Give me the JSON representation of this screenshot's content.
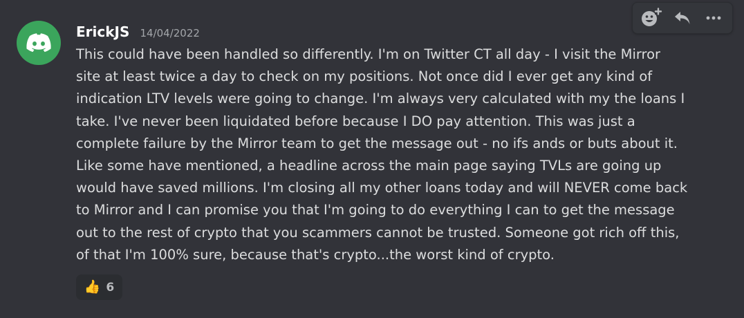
{
  "message": {
    "author": "ErickJS",
    "timestamp": "14/04/2022",
    "avatar_icon": "discord-logo-icon",
    "avatar_color": "#3ba55c",
    "text": "This could have been handled so differently. I'm on Twitter CT all day - I visit the Mirror\nsite at least twice a day to check on my positions. Not once did I ever get any kind of\nindication LTV levels were going to change. I'm always very calculated with my the loans I\ntake. I've never been liquidated before because I DO pay attention. This was just a\ncomplete failure by the Mirror team to get the message out - no ifs ands or buts about it.\nLike some have mentioned, a headline across the main page saying TVLs are going up\nwould have saved millions. I'm closing all my other loans today and will NEVER come back\nto Mirror and I can promise you that I'm going to do everything I can to get the message\nout to the rest of crypto that you scammers cannot be trusted. Someone got rich off this,\nof that I'm 100% sure, because that's crypto...the worst kind of crypto.",
    "reactions": [
      {
        "emoji": "👍",
        "icon": "thumbs-up-icon",
        "count": "6"
      }
    ]
  },
  "toolbar": {
    "buttons": [
      {
        "icon": "add-reaction-icon"
      },
      {
        "icon": "reply-icon"
      },
      {
        "icon": "more-options-icon"
      }
    ]
  },
  "colors": {
    "background": "#323339",
    "username": "#ffffff",
    "timestamp": "#a3a6aa",
    "text": "#dcddde"
  }
}
